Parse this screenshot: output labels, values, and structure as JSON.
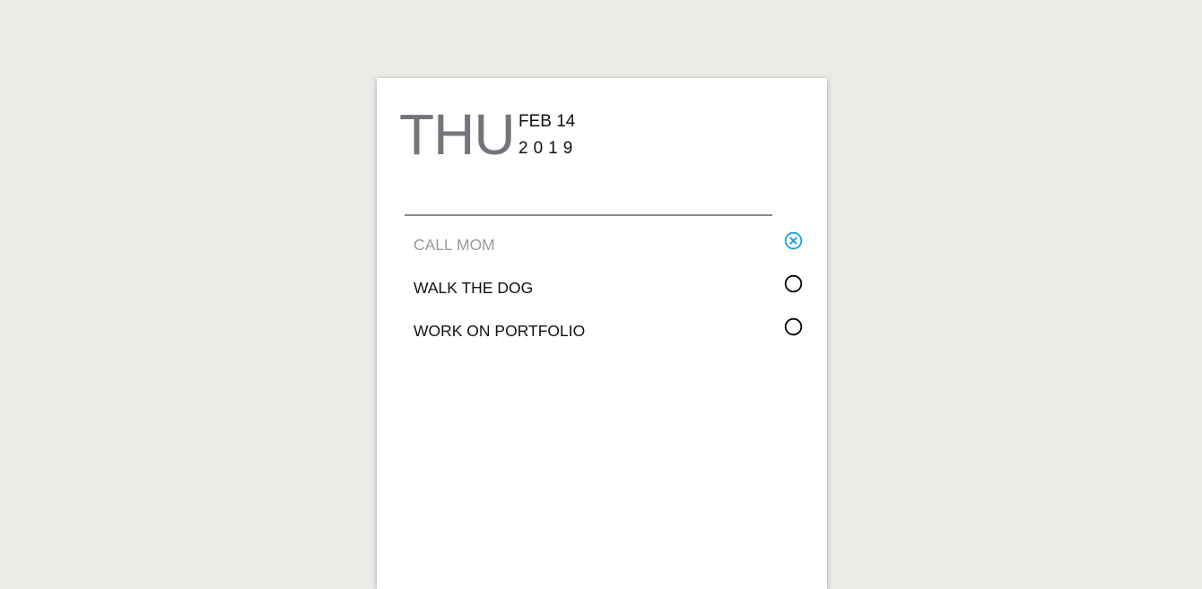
{
  "header": {
    "day": "THU",
    "month_day": "FEB 14",
    "year": "2019"
  },
  "new_todo": {
    "value": "",
    "placeholder": ""
  },
  "todos": [
    {
      "label": "CALL MOM",
      "done": true,
      "icon": "circle-x-icon"
    },
    {
      "label": "WALK THE DOG",
      "done": false,
      "icon": "circle-icon"
    },
    {
      "label": "WORK ON PORTFOLIO",
      "done": false,
      "icon": "circle-icon"
    }
  ],
  "colors": {
    "background": "#ebebe7",
    "card": "#ffffff",
    "day_text": "#74757b",
    "done_text": "#9a9a9a",
    "done_icon": "#1a9fd9",
    "pending_icon": "#000000"
  }
}
